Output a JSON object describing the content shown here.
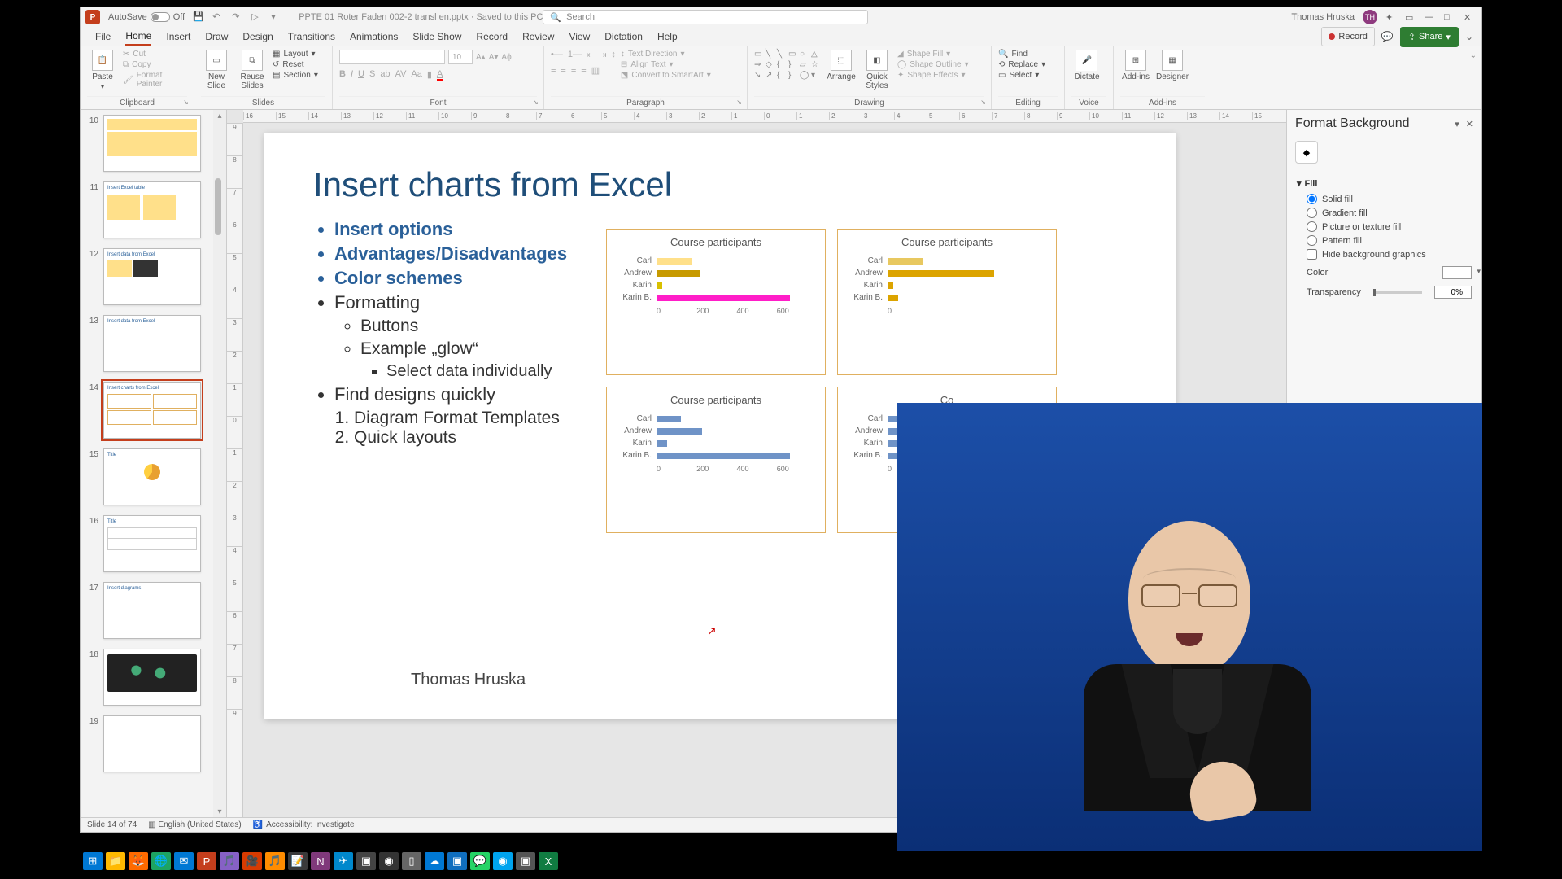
{
  "titlebar": {
    "app_icon_letter": "P",
    "autosave_label": "AutoSave",
    "autosave_state": "Off",
    "doc_title": "PPTE 01 Roter Faden 002-2 transl en.pptx · Saved to this PC",
    "search_placeholder": "Search",
    "user_name": "Thomas Hruska",
    "user_initials": "TH"
  },
  "tabs": {
    "file": "File",
    "home": "Home",
    "insert": "Insert",
    "draw": "Draw",
    "design": "Design",
    "transitions": "Transitions",
    "animations": "Animations",
    "slideshow": "Slide Show",
    "record": "Record",
    "review": "Review",
    "view": "View",
    "dictate_tab": "Dictation",
    "help": "Help",
    "record_btn": "Record",
    "share": "Share"
  },
  "ribbon": {
    "clipboard": {
      "paste": "Paste",
      "cut": "Cut",
      "copy": "Copy",
      "format_painter": "Format Painter",
      "group": "Clipboard"
    },
    "slides": {
      "new_slide": "New\nSlide",
      "reuse": "Reuse\nSlides",
      "layout": "Layout",
      "reset": "Reset",
      "section": "Section",
      "group": "Slides"
    },
    "font": {
      "size": "10",
      "group": "Font"
    },
    "paragraph": {
      "text_direction": "Text Direction",
      "align_text": "Align Text",
      "convert": "Convert to SmartArt",
      "group": "Paragraph"
    },
    "drawing": {
      "arrange": "Arrange",
      "quick_styles": "Quick\nStyles",
      "shape_fill": "Shape Fill",
      "shape_outline": "Shape Outline",
      "shape_effects": "Shape Effects",
      "group": "Drawing"
    },
    "editing": {
      "find": "Find",
      "replace": "Replace",
      "select": "Select",
      "group": "Editing"
    },
    "voice": {
      "dictate": "Dictate",
      "group": "Voice"
    },
    "addins": {
      "addins": "Add-ins",
      "designer": "Designer",
      "group": "Add-ins"
    }
  },
  "thumbnails": [
    {
      "num": "10"
    },
    {
      "num": "11"
    },
    {
      "num": "12"
    },
    {
      "num": "13"
    },
    {
      "num": "14",
      "selected": true
    },
    {
      "num": "15"
    },
    {
      "num": "16"
    },
    {
      "num": "17"
    },
    {
      "num": "18"
    },
    {
      "num": "19"
    }
  ],
  "ruler_h": [
    "16",
    "15",
    "14",
    "13",
    "12",
    "11",
    "10",
    "9",
    "8",
    "7",
    "6",
    "5",
    "4",
    "3",
    "2",
    "1",
    "0",
    "1",
    "2",
    "3",
    "4",
    "5",
    "6",
    "7",
    "8",
    "9",
    "10",
    "11",
    "12",
    "13",
    "14",
    "15",
    "16"
  ],
  "ruler_v": [
    "9",
    "8",
    "7",
    "6",
    "5",
    "4",
    "3",
    "2",
    "1",
    "0",
    "1",
    "2",
    "3",
    "4",
    "5",
    "6",
    "7",
    "8",
    "9"
  ],
  "slide": {
    "title": "Insert charts from Excel",
    "bullets_blue": [
      "Insert options",
      "Advantages/Disadvantages",
      "Color schemes"
    ],
    "bullets": {
      "formatting": "Formatting",
      "buttons": "Buttons",
      "example": "Example „glow“",
      "select_data": "Select data individually",
      "find_designs": "Find designs quickly",
      "dft": "Diagram Format Templates",
      "quick": "Quick layouts"
    },
    "footer": "Thomas Hruska"
  },
  "chart_data": [
    {
      "type": "bar",
      "title": "Course participants",
      "categories": [
        "Carl",
        "Andrew",
        "Karin",
        "Karin B."
      ],
      "values": [
        130,
        160,
        20,
        500
      ],
      "colors": [
        "#ffe08a",
        "#c79a00",
        "#d8c000",
        "#ff1ec8"
      ],
      "axis": [
        "0",
        "200",
        "400",
        "600"
      ],
      "xlim": [
        0,
        600
      ]
    },
    {
      "type": "bar",
      "title": "Course participants",
      "categories": [
        "Carl",
        "Andrew",
        "Karin",
        "Karin B."
      ],
      "values": [
        130,
        400,
        20,
        40
      ],
      "colors": [
        "#e8c860",
        "#dca400",
        "#dca400",
        "#dca400"
      ],
      "axis": [
        "0"
      ],
      "xlim": [
        0,
        600
      ]
    },
    {
      "type": "bar",
      "title": "Course participants",
      "categories": [
        "Carl",
        "Andrew",
        "Karin",
        "Karin B."
      ],
      "values": [
        90,
        170,
        40,
        500
      ],
      "colors": [
        "#6f93c7",
        "#6f93c7",
        "#6f93c7",
        "#6f93c7"
      ],
      "axis": [
        "0",
        "200",
        "400",
        "600"
      ],
      "xlim": [
        0,
        600
      ]
    },
    {
      "type": "bar",
      "title": "Co",
      "categories": [
        "Carl",
        "Andrew",
        "Karin",
        "Karin B."
      ],
      "values": [
        60,
        60,
        60,
        60
      ],
      "colors": [
        "#6f93c7",
        "#6f93c7",
        "#6f93c7",
        "#6f93c7"
      ],
      "axis": [
        "0"
      ],
      "xlim": [
        0,
        600
      ]
    }
  ],
  "format_panel": {
    "title": "Format Background",
    "fill": "Fill",
    "solid": "Solid fill",
    "gradient": "Gradient fill",
    "picture": "Picture or texture fill",
    "pattern": "Pattern fill",
    "hide": "Hide background graphics",
    "color": "Color",
    "transparency": "Transparency",
    "transparency_val": "0%"
  },
  "status": {
    "slide_of": "Slide 14 of 74",
    "lang": "English (United States)",
    "accessibility": "Accessibility: Investigate"
  },
  "taskbar_icons": [
    "⊞",
    "📁",
    "🦊",
    "🌐",
    "✉",
    "P",
    "🎵",
    "🎥",
    "🎵",
    "📝",
    "N",
    "✈",
    "▣",
    "◉",
    "▯",
    "☁",
    "▣",
    "💬",
    "◉",
    "▣",
    "X"
  ]
}
